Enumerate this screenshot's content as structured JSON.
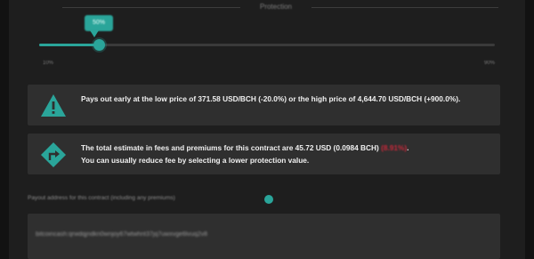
{
  "protection": {
    "title": "Protection",
    "tooltip": "50%",
    "value_percent": 50,
    "min_label": "10%",
    "max_label": "90%",
    "min": 10,
    "max": 90,
    "accent_color": "#2aa59a"
  },
  "cards": [
    {
      "icon": "warning-icon",
      "text": "Pays out early at the low price of 371.58 USD/BCH (-20.0%) or the high price of 4,644.70 USD/BCH (+900.0%)."
    },
    {
      "icon": "direction-sign-icon",
      "text_main": "The total estimate in fees and premiums for this contract are 45.72 USD (0.0984 BCH)",
      "text_pct": "(8.91%)",
      "text_end": ".",
      "text_line2": "You can usually reduce fee by selecting a lower protection value.",
      "pct_color": "#c8283a"
    }
  ],
  "payout": {
    "label": "Payout address for this contract (including any premiums)",
    "help_icon": "help-icon",
    "address": "bitcoincash:qrwdqjndkn0wnjoy67wtwhnt37jq7uwxvge6lvuq2v8"
  }
}
